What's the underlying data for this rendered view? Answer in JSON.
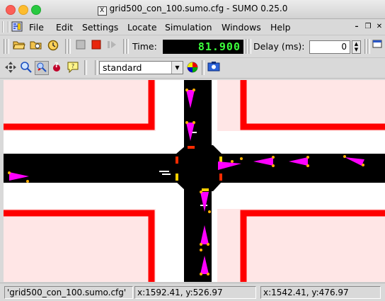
{
  "window": {
    "title": "grid500_con_100.sumo.cfg - SUMO 0.25.0"
  },
  "menubar": {
    "items": [
      "File",
      "Edit",
      "Settings",
      "Locate",
      "Simulation",
      "Windows",
      "Help"
    ]
  },
  "toolbar": {
    "time_label": "Time:",
    "time_value": "81.900",
    "delay_label": "Delay (ms):",
    "delay_value": "0"
  },
  "view_toolbar": {
    "scheme_value": "standard"
  },
  "statusbar": {
    "config": "'grid500_con_100.sumo.cfg'",
    "coord1": "x:1592.41, y:526.97",
    "coord2": "x:1542.41, y:476.97"
  },
  "colors": {
    "road": "#000000",
    "building": "#ffe6e6",
    "curb": "#ff0000",
    "vehicle": "#ff00ff"
  }
}
